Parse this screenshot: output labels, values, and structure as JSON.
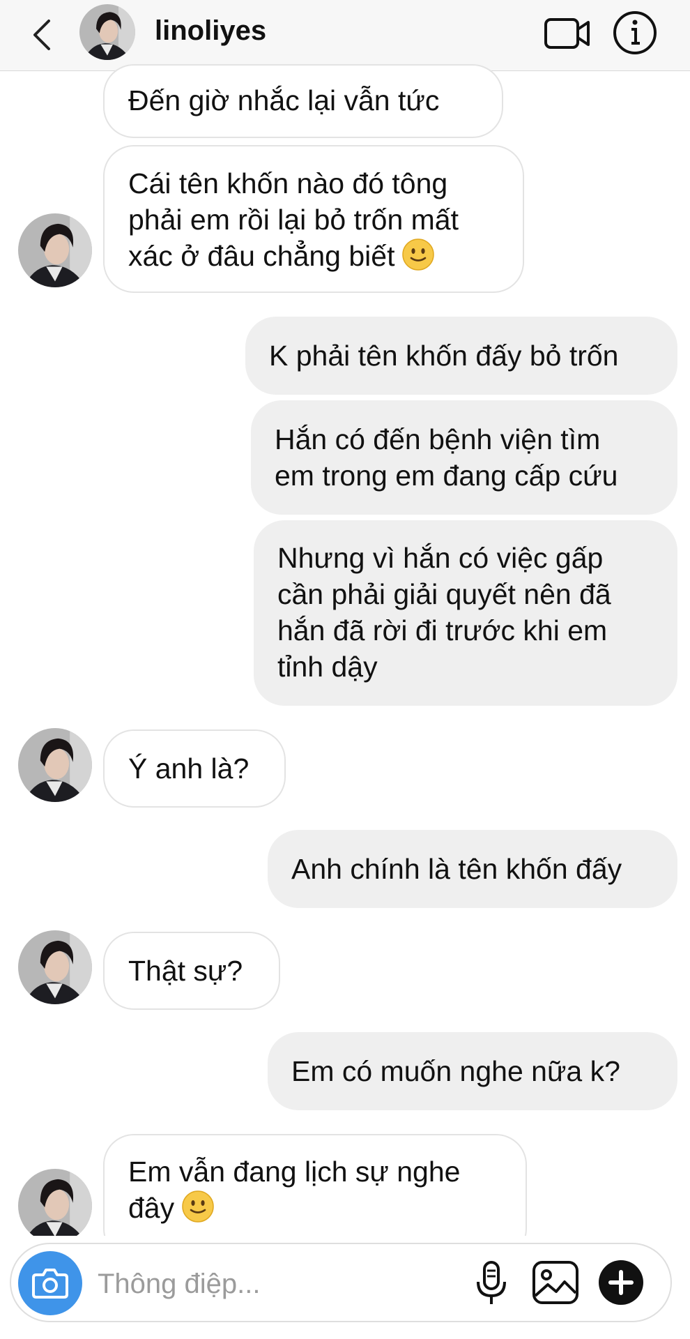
{
  "header": {
    "username": "linoliyes"
  },
  "messages": [
    {
      "side": "in",
      "lines": [
        "Đến giờ nhắc lại vẫn tức"
      ]
    },
    {
      "side": "in",
      "lines": [
        "Cái tên khốn nào đó tông",
        "phải em rồi lại bỏ trốn mất",
        "xác ở đâu chẳng biết"
      ],
      "emoji": "slightly-smiling-face"
    },
    {
      "side": "out",
      "lines": [
        "K phải tên khốn đấy bỏ trốn"
      ]
    },
    {
      "side": "out",
      "lines": [
        "Hắn có đến bệnh viện tìm",
        "em trong em đang cấp cứu"
      ]
    },
    {
      "side": "out",
      "lines": [
        "Nhưng vì hắn có việc gấp",
        "cần phải giải quyết nên đã",
        "hắn đã rời đi trước khi em",
        "tỉnh dậy"
      ]
    },
    {
      "side": "in",
      "lines": [
        "Ý anh là?"
      ]
    },
    {
      "side": "out",
      "lines": [
        "Anh chính là tên khốn đấy"
      ]
    },
    {
      "side": "in",
      "lines": [
        "Thật sự?"
      ]
    },
    {
      "side": "out",
      "lines": [
        "Em có muốn nghe nữa k?"
      ]
    },
    {
      "side": "in",
      "lines": [
        "Em vẫn đang lịch sự nghe",
        "đây"
      ],
      "emoji": "slightly-smiling-face"
    }
  ],
  "composer": {
    "placeholder": "Thông điệp..."
  },
  "colors": {
    "accent": "#3f94e9",
    "outgoing_bubble": "#efefef",
    "incoming_border": "#e3e3e3"
  }
}
